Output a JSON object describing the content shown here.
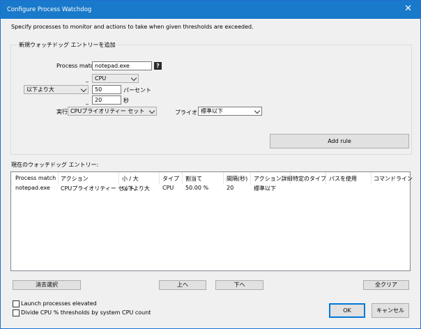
{
  "window": {
    "title": "Configure Process Watchdog",
    "close_glyph": "✕"
  },
  "description": "Specify processes to monitor and actions to take when given thresholds are exceeded.",
  "new_entry": {
    "group_label": "新規ウォッチドッグ エントリーを追加",
    "process_match_label": "Process match:",
    "process_match_value": "notepad.exe",
    "help_glyph": "?",
    "resource_select": "CPU",
    "comparison_select": "以下より大",
    "threshold_value": "50",
    "threshold_unit": "パーセント",
    "duration_value": "20",
    "duration_unit": "秒",
    "underscore_a": "_",
    "underscore_b": "_",
    "action_label": "実行",
    "action_select": "CPUプライオリティー セット",
    "priority_label": "プライオリ",
    "priority_select": "標準以下",
    "add_rule_button": "Add rule"
  },
  "existing": {
    "label": "現在のウォッチドッグ エントリー:",
    "columns": [
      "Process match",
      "アクション",
      "小 / 大",
      "タイプ",
      "割当て",
      "間隔(秒)",
      "アクション詳細",
      "特定のタイプ",
      "パスを使用",
      "コマンドライン"
    ],
    "rows": [
      [
        "notepad.exe",
        "CPUプライオリティー セット",
        "以下より大",
        "CPU",
        "50.00 %",
        "20",
        "標準以下",
        "",
        "",
        ""
      ]
    ]
  },
  "buttons": {
    "clear_selection": "消去選択",
    "up": "上へ",
    "down": "下へ",
    "clear_all": "全クリア",
    "ok": "OK",
    "cancel": "キャンセル"
  },
  "options": {
    "launch_elevated": "Launch processes elevated",
    "divide_cpu": "Divide CPU % thresholds by system CPU count"
  },
  "colors": {
    "titlebar": "#1979ca",
    "ok_border": "#0078d7"
  }
}
